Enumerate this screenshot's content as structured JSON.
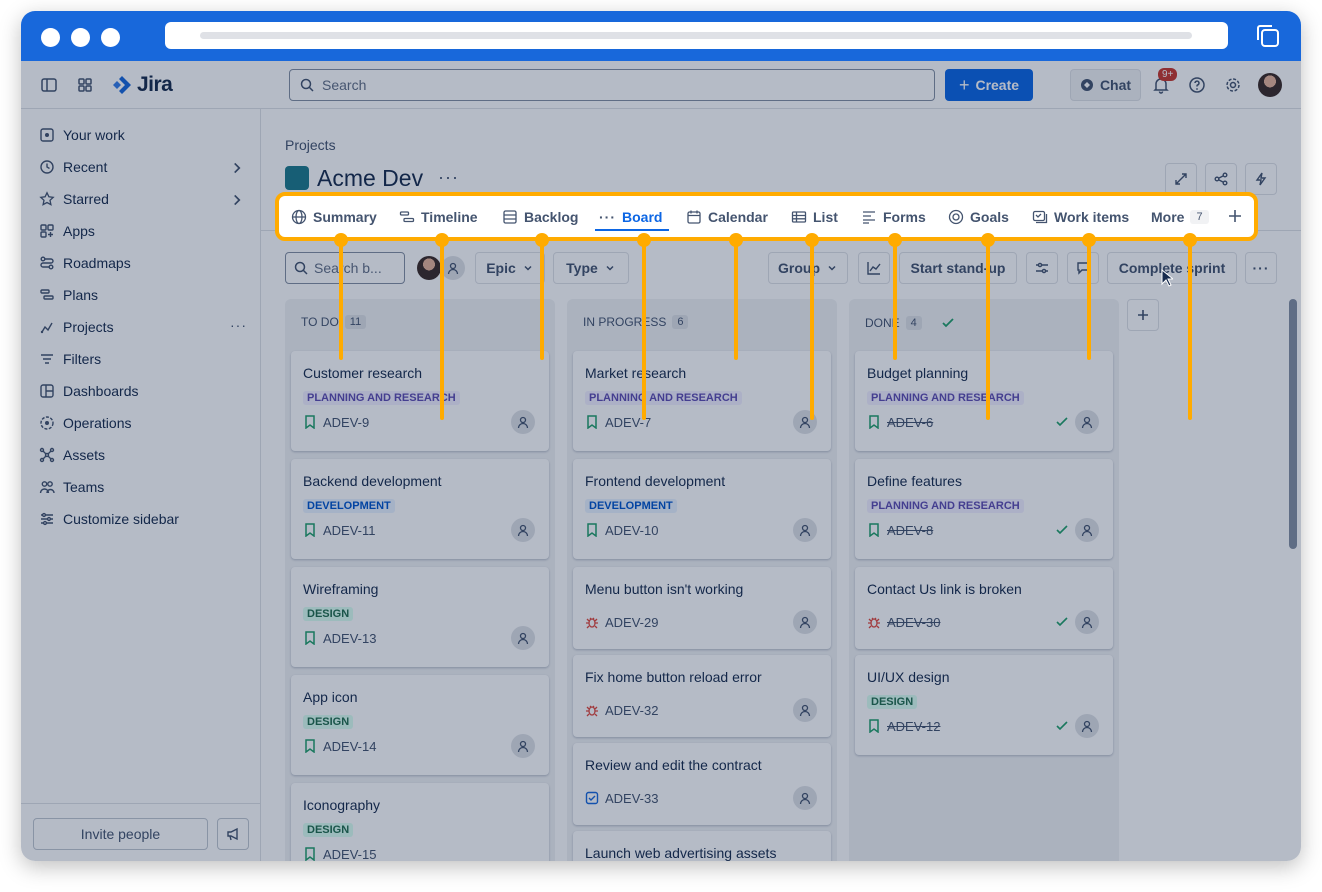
{
  "topnav": {
    "app_name": "Jira",
    "search_placeholder": "Search",
    "create_label": "Create",
    "chat_label": "Chat",
    "notification_badge": "9+"
  },
  "sidebar": {
    "items": [
      {
        "label": "Your work",
        "icon": "your-work-icon"
      },
      {
        "label": "Recent",
        "icon": "clock-icon"
      },
      {
        "label": "Starred",
        "icon": "star-icon"
      },
      {
        "label": "Apps",
        "icon": "apps-icon"
      },
      {
        "label": "Roadmaps",
        "icon": "roadmaps-icon"
      },
      {
        "label": "Plans",
        "icon": "plans-icon"
      },
      {
        "label": "Projects",
        "icon": "projects-icon"
      },
      {
        "label": "Filters",
        "icon": "filters-icon"
      },
      {
        "label": "Dashboards",
        "icon": "dashboards-icon"
      },
      {
        "label": "Operations",
        "icon": "operations-icon"
      },
      {
        "label": "Assets",
        "icon": "assets-icon"
      },
      {
        "label": "Teams",
        "icon": "teams-icon"
      },
      {
        "label": "Customize sidebar",
        "icon": "customize-icon"
      }
    ],
    "invite_label": "Invite people"
  },
  "project": {
    "breadcrumb": "Projects",
    "title": "Acme Dev",
    "more": "···"
  },
  "tabs": [
    {
      "label": "Summary",
      "icon": "globe-icon"
    },
    {
      "label": "Timeline",
      "icon": "timeline-icon"
    },
    {
      "label": "Backlog",
      "icon": "backlog-icon"
    },
    {
      "label": "Board",
      "icon": "board-icon"
    },
    {
      "label": "Calendar",
      "icon": "calendar-icon"
    },
    {
      "label": "List",
      "icon": "list-icon"
    },
    {
      "label": "Forms",
      "icon": "forms-icon"
    },
    {
      "label": "Goals",
      "icon": "goals-icon"
    },
    {
      "label": "Work items",
      "icon": "work-items-icon"
    },
    {
      "label": "More",
      "icon": "more-icon",
      "count": "7"
    }
  ],
  "toolbar": {
    "search_placeholder": "Search b...",
    "epic_label": "Epic",
    "type_label": "Type",
    "group_label": "Group",
    "standup_label": "Start stand-up",
    "complete_label": "Complete sprint"
  },
  "columns": [
    {
      "name": "TO DO",
      "count": "11",
      "cards": [
        {
          "title": "Customer research",
          "label": "PLANNING AND RESEARCH",
          "key": "ADEV-9",
          "type": "story"
        },
        {
          "title": "Backend development",
          "label": "DEVELOPMENT",
          "key": "ADEV-11",
          "type": "story"
        },
        {
          "title": "Wireframing",
          "label": "DESIGN",
          "key": "ADEV-13",
          "type": "story"
        },
        {
          "title": "App icon",
          "label": "DESIGN",
          "key": "ADEV-14",
          "type": "story"
        },
        {
          "title": "Iconography",
          "label": "DESIGN",
          "key": "ADEV-15",
          "type": "story"
        }
      ]
    },
    {
      "name": "IN PROGRESS",
      "count": "6",
      "cards": [
        {
          "title": "Market research",
          "label": "PLANNING AND RESEARCH",
          "key": "ADEV-7",
          "type": "story"
        },
        {
          "title": "Frontend development",
          "label": "DEVELOPMENT",
          "key": "ADEV-10",
          "type": "story"
        },
        {
          "title": "Menu button isn't working",
          "label": "",
          "key": "ADEV-29",
          "type": "bug"
        },
        {
          "title": "Fix home button reload error",
          "label": "",
          "key": "ADEV-32",
          "type": "bug"
        },
        {
          "title": "Review and edit the contract",
          "label": "",
          "key": "ADEV-33",
          "type": "task"
        },
        {
          "title": "Launch web advertising assets",
          "label": "",
          "key": "",
          "type": "story"
        }
      ]
    },
    {
      "name": "DONE",
      "count": "4",
      "cards": [
        {
          "title": "Budget planning",
          "label": "PLANNING AND RESEARCH",
          "key": "ADEV-6",
          "type": "story"
        },
        {
          "title": "Define features",
          "label": "PLANNING AND RESEARCH",
          "key": "ADEV-8",
          "type": "story"
        },
        {
          "title": "Contact Us link is broken",
          "label": "",
          "key": "ADEV-30",
          "type": "bug"
        },
        {
          "title": "UI/UX design",
          "label": "DESIGN",
          "key": "ADEV-12",
          "type": "story"
        }
      ]
    }
  ],
  "colors": {
    "brand_blue": "#1868db",
    "highlight": "#ffab00",
    "primary": "#0c66e4"
  }
}
